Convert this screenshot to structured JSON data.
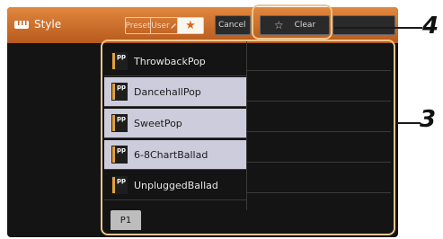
{
  "header": {
    "title": "Style",
    "tabs": [
      "Preset",
      "User"
    ],
    "favorite_tab": "★",
    "buttons": {
      "cancel": "Cancel",
      "clear": "Clear",
      "clear_icon": "☆"
    }
  },
  "styles": [
    {
      "name": "ThrowbackPop",
      "selected": false,
      "icon": "P^pp"
    },
    {
      "name": "DancehallPop",
      "selected": true,
      "icon": "P^pp"
    },
    {
      "name": "SweetPop",
      "selected": true,
      "icon": "P^pp"
    },
    {
      "name": "6-8ChartBallad",
      "selected": true,
      "icon": "P^pp"
    },
    {
      "name": "UnpluggedBallad",
      "selected": false,
      "icon": "P^pp"
    }
  ],
  "page_tab": "P1",
  "callouts": [
    "4",
    "3"
  ],
  "colors": {
    "header": "#c96a25",
    "selected_row": "#ccccdc",
    "callout": "#eec58d",
    "icon_bar": "#e2a13c"
  }
}
